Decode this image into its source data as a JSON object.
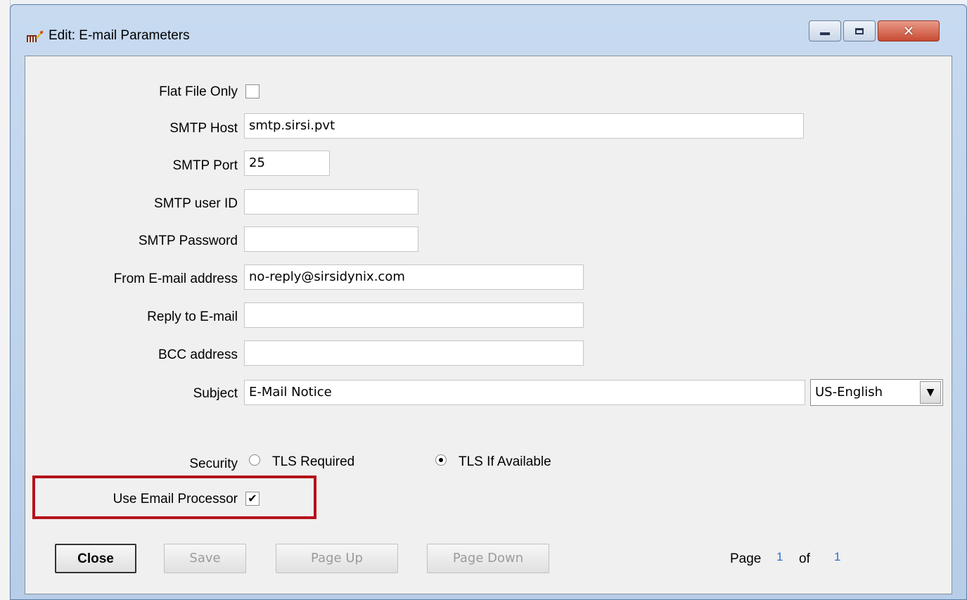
{
  "window": {
    "title": "Edit: E-mail Parameters",
    "controls": {
      "minimize": "minimize",
      "maximize": "maximize",
      "close": "✕"
    }
  },
  "form": {
    "flat_file_only": {
      "label": "Flat File Only",
      "checked": false
    },
    "smtp_host": {
      "label": "SMTP Host",
      "value": "smtp.sirsi.pvt"
    },
    "smtp_port": {
      "label": "SMTP Port",
      "value": "25"
    },
    "smtp_user_id": {
      "label": "SMTP user ID",
      "value": ""
    },
    "smtp_password": {
      "label": "SMTP Password",
      "value": ""
    },
    "from_email": {
      "label": "From E-mail address",
      "value": "no-reply@sirsidynix.com"
    },
    "reply_to": {
      "label": "Reply to E-mail",
      "value": ""
    },
    "bcc": {
      "label": "BCC address",
      "value": ""
    },
    "subject": {
      "label": "Subject",
      "value": "E-Mail Notice",
      "language": "US-English"
    },
    "security": {
      "label": "Security",
      "options": [
        "TLS Required",
        "TLS If Available"
      ],
      "selected": "TLS If Available"
    },
    "use_email_processor": {
      "label": "Use Email Processor",
      "checked": true
    }
  },
  "buttons": {
    "close": "Close",
    "save": "Save",
    "page_up": "Page Up",
    "page_down": "Page Down"
  },
  "pagination": {
    "page_label": "Page",
    "current": "1",
    "of_label": "of",
    "total": "1"
  },
  "colors": {
    "highlight": "#b5121b",
    "page_number": "#2f6fc9"
  }
}
